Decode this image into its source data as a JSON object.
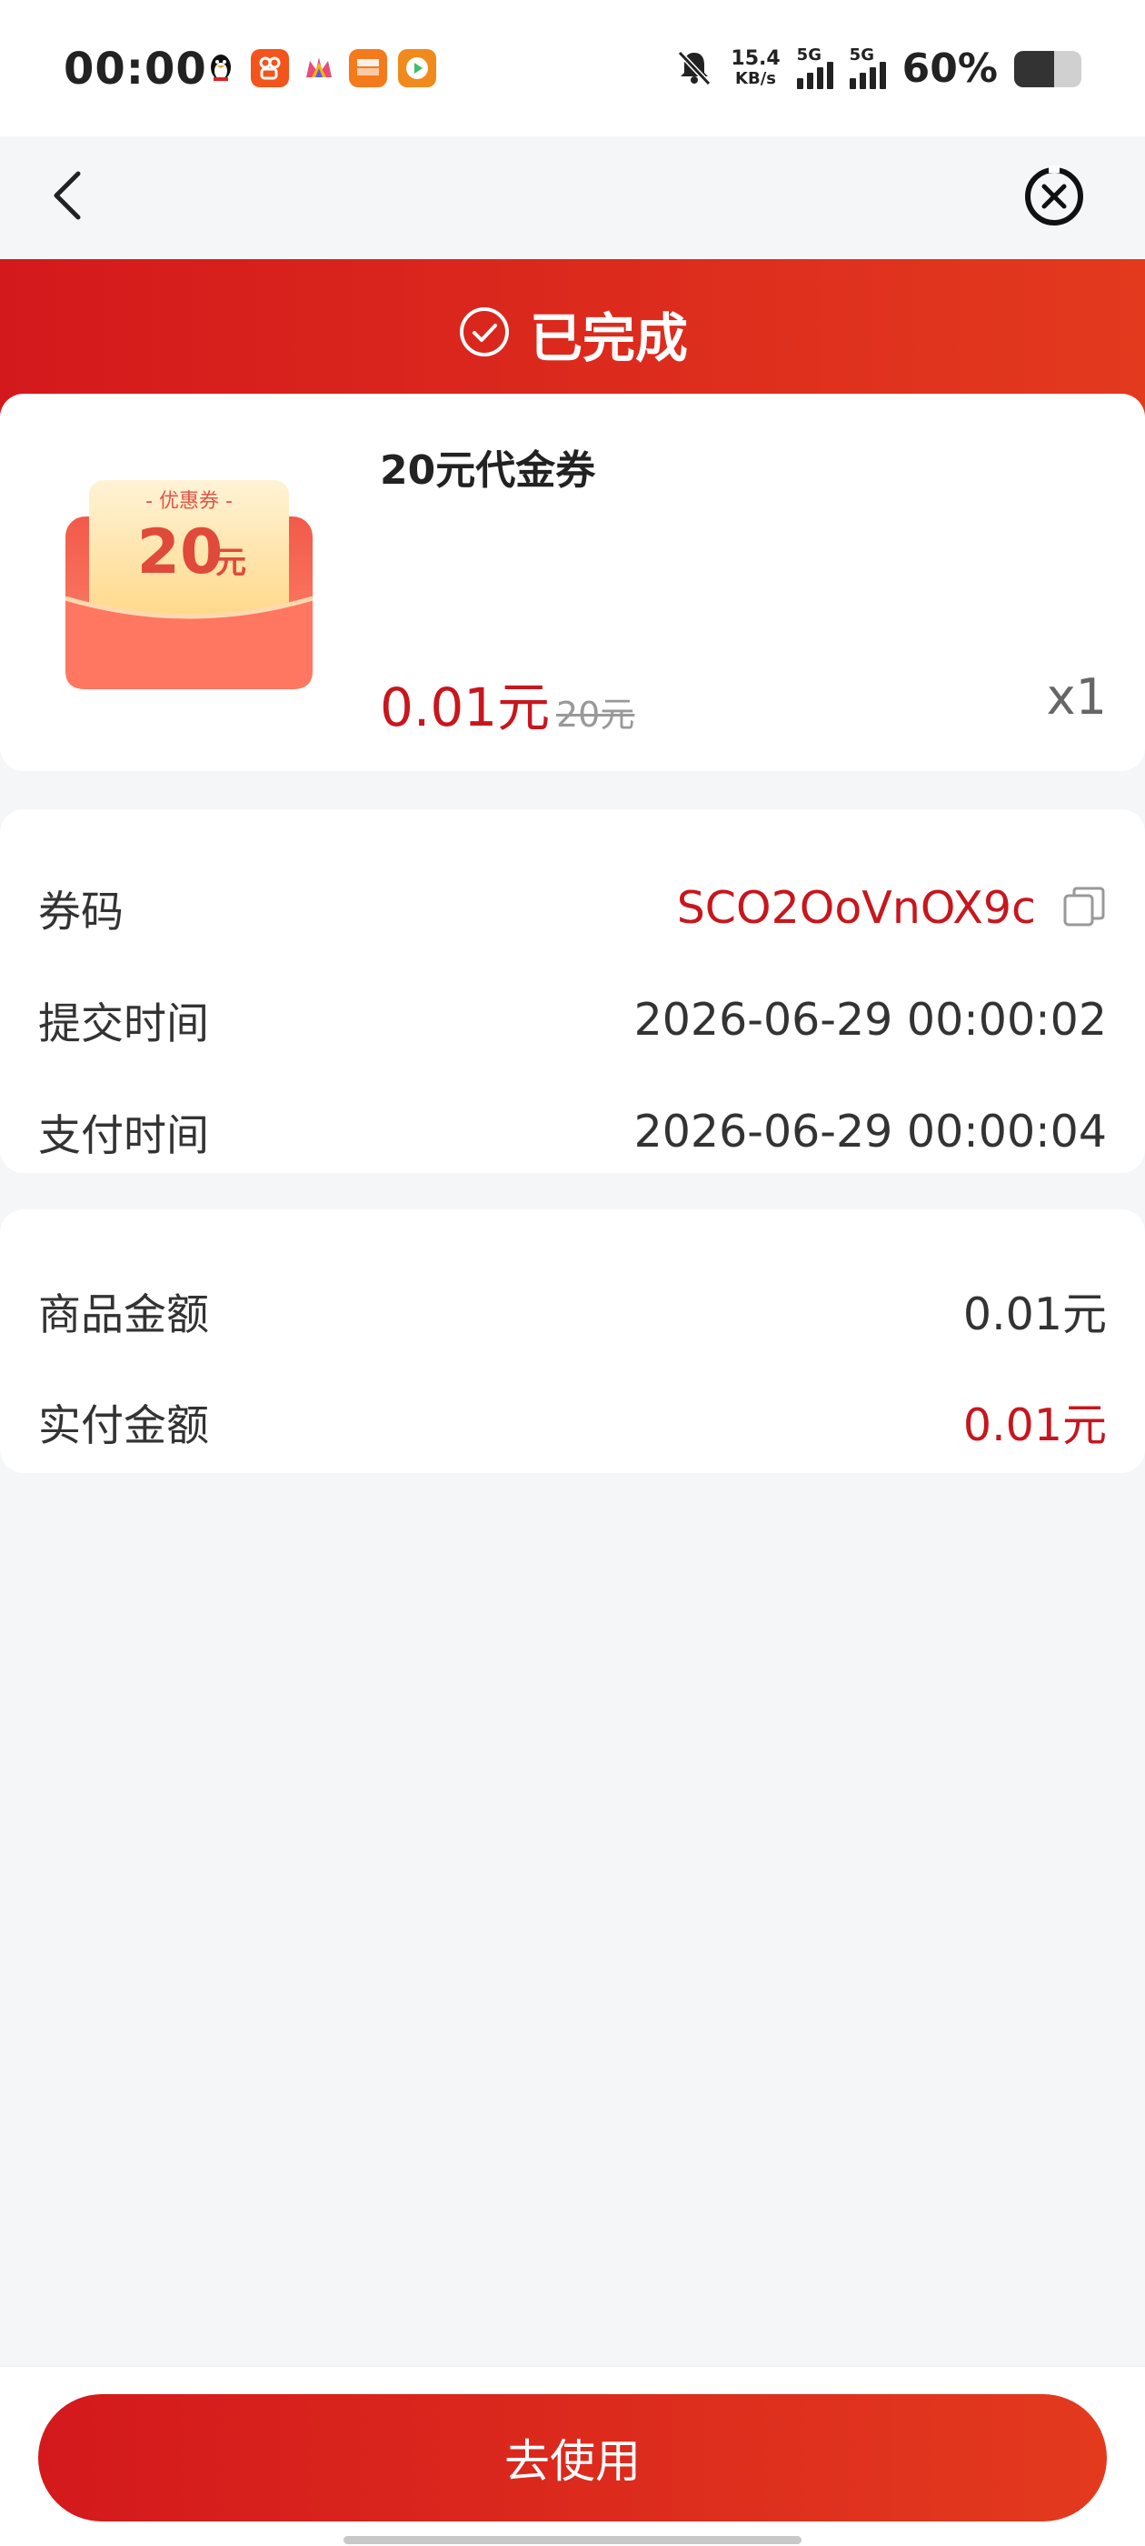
{
  "status_bar": {
    "time": "00:00",
    "net_speed": "15.4",
    "net_speed_unit": "KB/s",
    "signal_tag": "5G",
    "battery_percent": "60%",
    "battery_level": 0.6,
    "icons": [
      "penguin-icon",
      "kuaishou-icon",
      "crown-icon",
      "taobao-icon",
      "video-play-icon",
      "bell-muted-icon"
    ]
  },
  "nav": {
    "back_icon": "chevron-left-icon",
    "close_icon": "close-circle-icon"
  },
  "order": {
    "status": "已完成",
    "product_name": "20元代金券",
    "coupon_image_tag": "- 优惠券 -",
    "coupon_image_value": "20",
    "coupon_image_unit": "元",
    "price": "0.01元",
    "original_price": "20元",
    "quantity": "x1"
  },
  "info": {
    "code_label": "券码",
    "code_value": "SCO2OoVnOX9c",
    "submit_label": "提交时间",
    "submit_value": "2026-06-29 00:00:02",
    "pay_label": "支付时间",
    "pay_value": "2026-06-29 00:00:04"
  },
  "amounts": {
    "goods_label": "商品金额",
    "goods_value": "0.01元",
    "paid_label": "实付金额",
    "paid_value": "0.01元"
  },
  "footer": {
    "use_button": "去使用"
  },
  "colors": {
    "accent": "#d4191c",
    "price_red": "#c8161d",
    "background": "#f5f6f8"
  }
}
